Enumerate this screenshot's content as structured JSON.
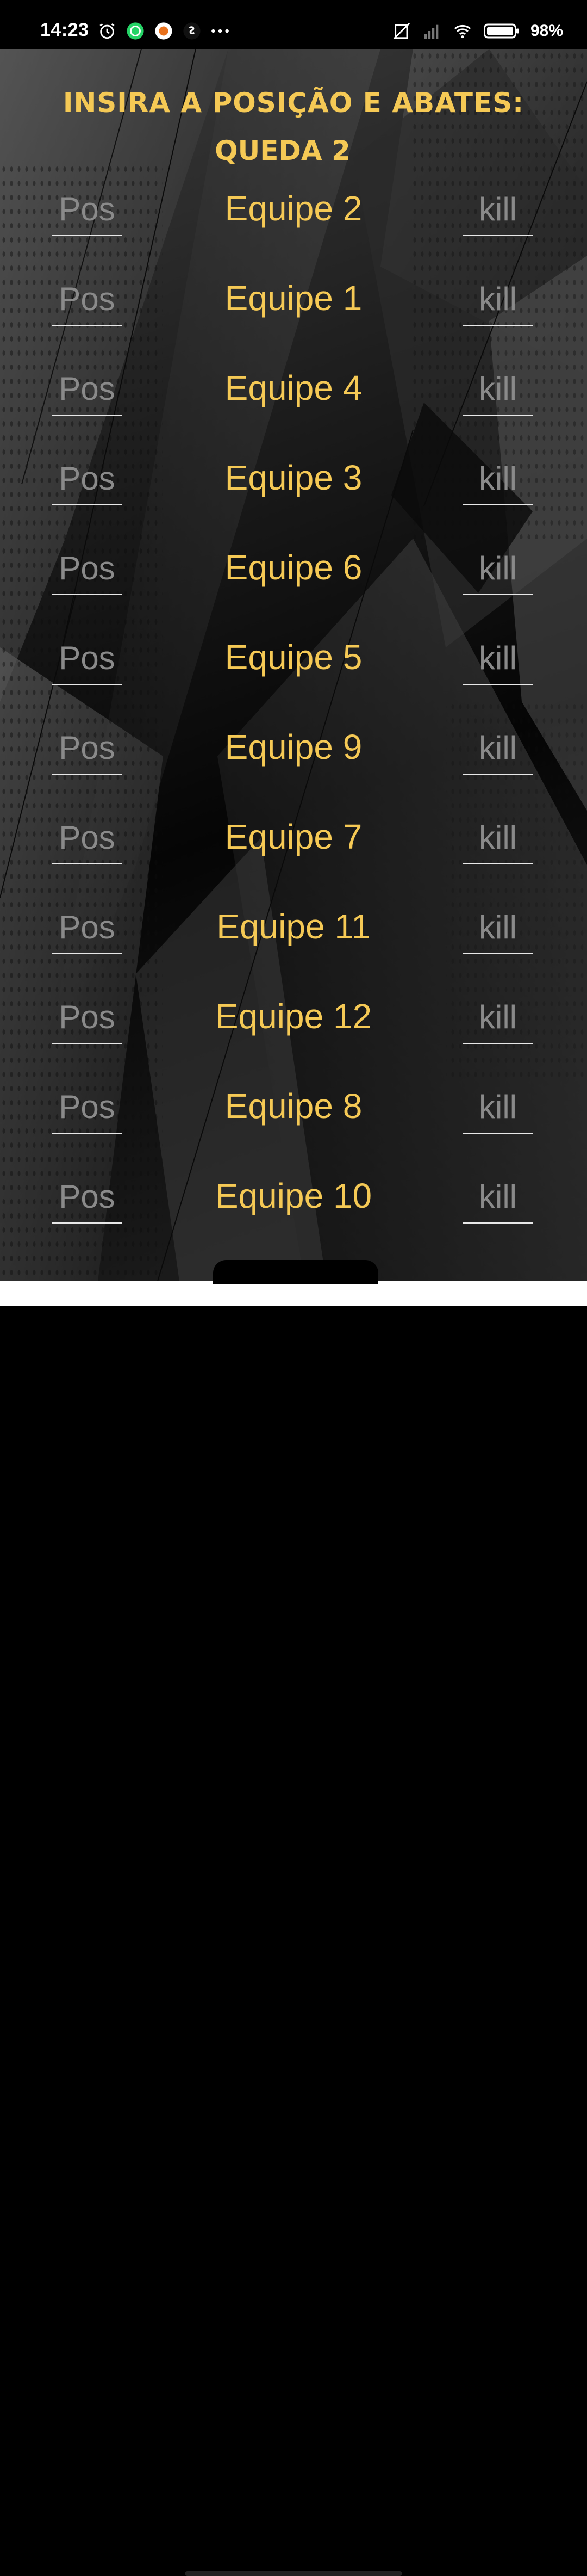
{
  "status_bar": {
    "time": "14:23",
    "battery": "98%",
    "icons": [
      "alarm-icon",
      "whatsapp-icon",
      "app-notification-icon",
      "shazam-icon",
      "more-dots-icon",
      "no-sim-icon",
      "signal-icon",
      "wifi-icon",
      "battery-icon"
    ]
  },
  "header": {
    "title": "INSIRA A POSIÇÃO E ABATES:",
    "subtitle": "QUEDA 2"
  },
  "form": {
    "pos_placeholder": "Pos",
    "kill_placeholder": "kill",
    "teams": [
      {
        "name": "Equipe 2"
      },
      {
        "name": "Equipe 1"
      },
      {
        "name": "Equipe 4"
      },
      {
        "name": "Equipe 3"
      },
      {
        "name": "Equipe 6"
      },
      {
        "name": "Equipe 5"
      },
      {
        "name": "Equipe 9"
      },
      {
        "name": "Equipe 7"
      },
      {
        "name": "Equipe 11"
      },
      {
        "name": "Equipe 12"
      },
      {
        "name": "Equipe 8"
      },
      {
        "name": "Equipe 10"
      }
    ]
  },
  "colors": {
    "accent": "#f5c955",
    "placeholder": "#8a8a8a",
    "underline": "#e8e8e8"
  }
}
